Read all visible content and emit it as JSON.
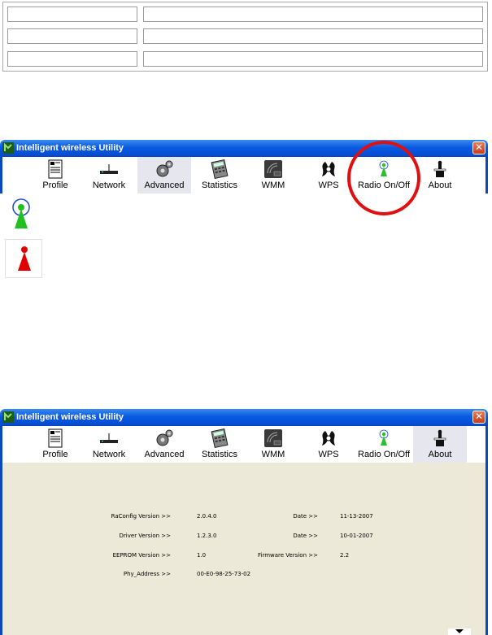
{
  "window": {
    "title": "Intelligent wireless Utility",
    "close_glyph": "✕"
  },
  "toolbar": {
    "items": [
      {
        "label": "Profile",
        "icon": "profile-icon"
      },
      {
        "label": "Network",
        "icon": "network-icon"
      },
      {
        "label": "Advanced",
        "icon": "advanced-gear-icon"
      },
      {
        "label": "Statistics",
        "icon": "statistics-icon"
      },
      {
        "label": "WMM",
        "icon": "wmm-icon"
      },
      {
        "label": "WPS",
        "icon": "wps-icon"
      },
      {
        "label": "Radio On/Off",
        "icon": "radio-icon"
      },
      {
        "label": "About",
        "icon": "about-icon"
      }
    ],
    "active_top": "Advanced",
    "active_bottom": "About"
  },
  "radio_states": [
    {
      "state": "on",
      "icon": "radio-on-icon",
      "color": "#20c020"
    },
    {
      "state": "off",
      "icon": "radio-off-icon",
      "color": "#e00000"
    }
  ],
  "about": {
    "raconfig_label": "RaConfig Version >>",
    "raconfig_value": "2.0.4.0",
    "date1_label": "Date >>",
    "date1_value": "11-13-2007",
    "driver_label": "Driver Version >>",
    "driver_value": "1.2.3.0",
    "date2_label": "Date >>",
    "date2_value": "10-01-2007",
    "eeprom_label": "EEPROM Version >>",
    "eeprom_value": "1.0",
    "firmware_label": "Firmware Version >>",
    "firmware_value": "2.2",
    "phy_label": "Phy_Address >>",
    "phy_value": "00-E0-98-25-73-02"
  },
  "colors": {
    "titlebar": "#0a5ae0",
    "panel_bg": "#ece9d8",
    "highlight_circle": "#e01010"
  }
}
